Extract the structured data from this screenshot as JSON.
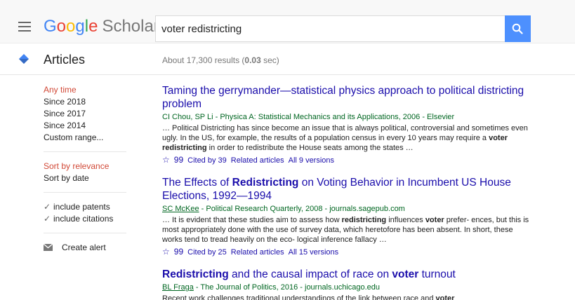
{
  "header": {
    "logo": {
      "g1": "G",
      "g2": "o",
      "g3": "o",
      "g4": "g",
      "g5": "l",
      "g6": "e",
      "scholar": "Scholar"
    },
    "search_value": "voter redistricting",
    "accent_color": "#4d90fe"
  },
  "articles_row": {
    "label": "Articles",
    "stats_prefix": "About 17,300 results (",
    "stats_time": "0.03",
    "stats_suffix": " sec)"
  },
  "sidebar": {
    "time_filters": [
      "Any time",
      "Since 2018",
      "Since 2017",
      "Since 2014",
      "Custom range..."
    ],
    "sort": [
      "Sort by relevance",
      "Sort by date"
    ],
    "include": [
      "include patents",
      "include citations"
    ],
    "create_alert": "Create alert"
  },
  "results": [
    {
      "title_parts": [
        {
          "t": "Taming the gerrymander—statistical physics approach to political districting problem",
          "b": false
        }
      ],
      "author": "CI Chou, SP Li",
      "source": " - Physica A: Statistical Mechanics and its Applications, 2006 - Elsevier",
      "snippet_parts": [
        {
          "t": "… Political Districting has since become an issue that is always political, controversial and sometimes even ugly. In the US, for example, the results of a population census in every 10 years may require a ",
          "b": false
        },
        {
          "t": "voter redistricting",
          "b": true
        },
        {
          "t": " in order to redistribute the House seats among the states …",
          "b": false
        }
      ],
      "cited": "Cited by 39",
      "related": "Related articles",
      "versions": "All 9 versions",
      "author_underlined": false
    },
    {
      "title_parts": [
        {
          "t": "The Effects of ",
          "b": false
        },
        {
          "t": "Redistricting",
          "b": true
        },
        {
          "t": " on Voting Behavior in Incumbent US House Elections, 1992—1994",
          "b": false
        }
      ],
      "author": "SC McKee",
      "source": " - Political Research Quarterly, 2008 - journals.sagepub.com",
      "snippet_parts": [
        {
          "t": "… It is evident that these studies aim to assess how ",
          "b": false
        },
        {
          "t": "redistricting",
          "b": true
        },
        {
          "t": " influences ",
          "b": false
        },
        {
          "t": "voter",
          "b": true
        },
        {
          "t": " prefer- ences, but this is most appropriately done with the use of survey data, which heretofore has been absent. In short, these works tend to tread heavily on the eco- logical inference fallacy …",
          "b": false
        }
      ],
      "cited": "Cited by 25",
      "related": "Related articles",
      "versions": "All 15 versions",
      "author_underlined": true
    },
    {
      "title_parts": [
        {
          "t": "Redistricting",
          "b": true
        },
        {
          "t": " and the causal impact of race on ",
          "b": false
        },
        {
          "t": "voter",
          "b": true
        },
        {
          "t": " turnout",
          "b": false
        }
      ],
      "author": "BL Fraga",
      "source": " - The Journal of Politics, 2016 - journals.uchicago.edu",
      "snippet_parts": [
        {
          "t": "Recent work challenges traditional understandings of the link between race and ",
          "b": false
        },
        {
          "t": "voter",
          "b": true
        }
      ],
      "cited": "",
      "related": "",
      "versions": "",
      "author_underlined": true
    }
  ],
  "link_icons": {
    "save": "☆",
    "cite": "99"
  }
}
